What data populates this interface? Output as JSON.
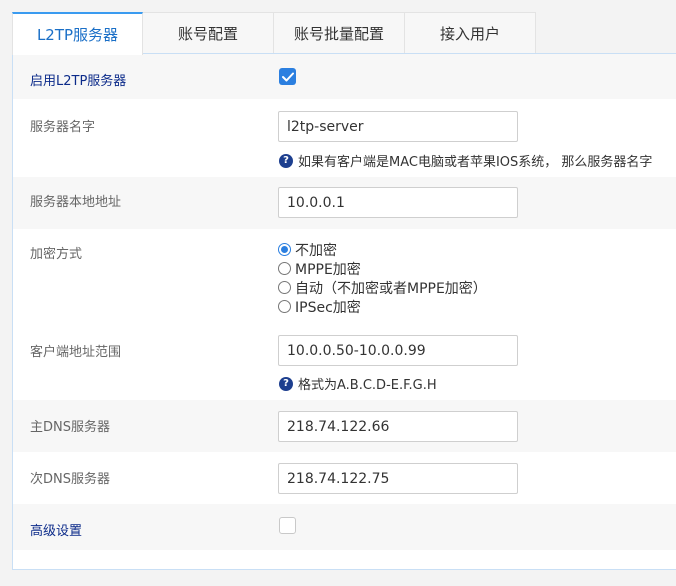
{
  "tabs": [
    {
      "label": "L2TP服务器",
      "active": true
    },
    {
      "label": "账号配置",
      "active": false
    },
    {
      "label": "账号批量配置",
      "active": false
    },
    {
      "label": "接入用户",
      "active": false
    }
  ],
  "form": {
    "enable": {
      "label": "启用L2TP服务器",
      "checked": true
    },
    "server_name": {
      "label": "服务器名字",
      "value": "l2tp-server",
      "hint": "如果有客户端是MAC电脑或者苹果IOS系统， 那么服务器名字"
    },
    "local_address": {
      "label": "服务器本地地址",
      "value": "10.0.0.1"
    },
    "encryption": {
      "label": "加密方式",
      "options": [
        "不加密",
        "MPPE加密",
        "自动（不加密或者MPPE加密）",
        "IPSec加密"
      ],
      "selected": "不加密"
    },
    "client_range": {
      "label": "客户端地址范围",
      "value": "10.0.0.50-10.0.0.99",
      "hint": "格式为A.B.C.D-E.F.G.H"
    },
    "primary_dns": {
      "label": "主DNS服务器",
      "value": "218.74.122.66"
    },
    "secondary_dns": {
      "label": "次DNS服务器",
      "value": "218.74.122.75"
    },
    "advanced": {
      "label": "高级设置",
      "checked": false
    }
  },
  "colors": {
    "accent": "#2b7fe0",
    "label_blue": "#0c2b8a",
    "shade": "#f7f7f7"
  }
}
